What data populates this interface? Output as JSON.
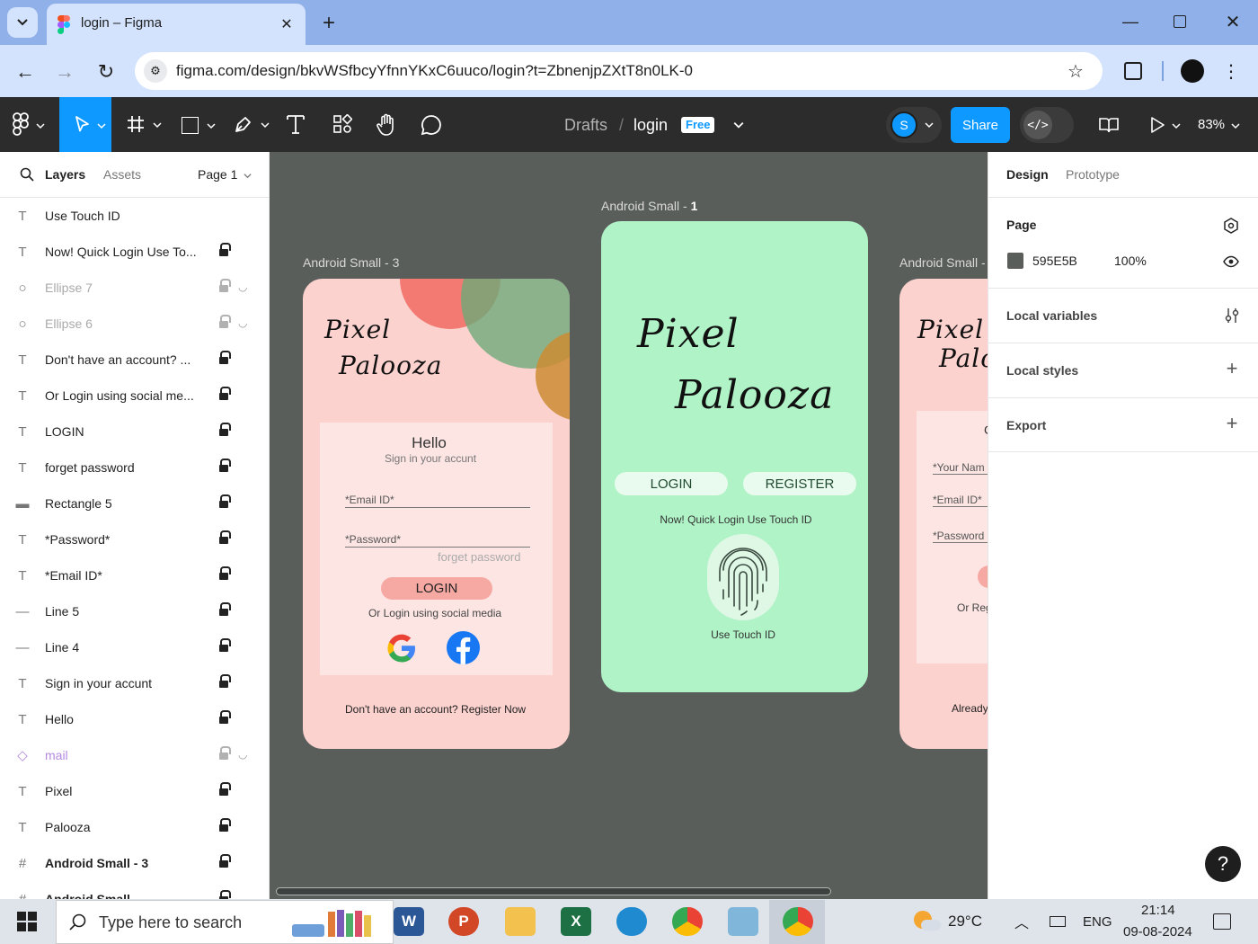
{
  "browser": {
    "tab_title": "login – Figma",
    "url": "figma.com/design/bkvWSfbcyYfnnYKxC6uuco/login?t=ZbnenjpZXtT8n0LK-0"
  },
  "toolbar": {
    "breadcrumb_parent": "Drafts",
    "breadcrumb_sep": "/",
    "file_name": "login",
    "plan_badge": "Free",
    "avatar_letter": "S",
    "share_label": "Share",
    "zoom": "83%"
  },
  "left_panel": {
    "tab_layers": "Layers",
    "tab_assets": "Assets",
    "page_selector": "Page 1",
    "layers": [
      {
        "name": "Use Touch ID",
        "type": "text",
        "locked": false
      },
      {
        "name": "Now! Quick Login Use To...",
        "type": "text",
        "locked": true
      },
      {
        "name": "Ellipse 7",
        "type": "ellipse",
        "locked": true,
        "hidden": true
      },
      {
        "name": "Ellipse 6",
        "type": "ellipse",
        "locked": true,
        "hidden": true
      },
      {
        "name": "Don't have an account? ...",
        "type": "text",
        "locked": true
      },
      {
        "name": "Or Login using social me...",
        "type": "text",
        "locked": true
      },
      {
        "name": "LOGIN",
        "type": "text",
        "locked": true
      },
      {
        "name": "forget password",
        "type": "text",
        "locked": true
      },
      {
        "name": "Rectangle 5",
        "type": "rect",
        "locked": true
      },
      {
        "name": "*Password*",
        "type": "text",
        "locked": true
      },
      {
        "name": "*Email ID*",
        "type": "text",
        "locked": true
      },
      {
        "name": "Line 5",
        "type": "line",
        "locked": true
      },
      {
        "name": "Line 4",
        "type": "line",
        "locked": true
      },
      {
        "name": "Sign in your accunt",
        "type": "text",
        "locked": true
      },
      {
        "name": "Hello",
        "type": "text",
        "locked": true
      },
      {
        "name": "mail",
        "type": "component",
        "locked": true,
        "hidden": true
      },
      {
        "name": "Pixel",
        "type": "text",
        "locked": true
      },
      {
        "name": "Palooza",
        "type": "text",
        "locked": true
      },
      {
        "name": "Android Small - 3",
        "type": "frame",
        "locked": true
      },
      {
        "name": "Android Small",
        "type": "frame",
        "locked": true
      }
    ]
  },
  "right_panel": {
    "tab_design": "Design",
    "tab_prototype": "Prototype",
    "page_heading": "Page",
    "page_color_hex": "595E5B",
    "page_opacity": "100%",
    "local_variables": "Local variables",
    "local_styles": "Local styles",
    "export": "Export"
  },
  "canvas": {
    "background": "#595e5b",
    "frame3": {
      "label": "Android Small - 3",
      "title_1": "Pixel",
      "title_2": "Palooza",
      "hello": "Hello",
      "subtitle": "Sign in your accunt",
      "email_placeholder": "*Email ID*",
      "password_placeholder": "*Password*",
      "forget": "forget password",
      "login_button": "LOGIN",
      "social_text": "Or Login using social media",
      "register_text": "Don't have an account? Register Now"
    },
    "frame1": {
      "label_prefix": "Android Small - ",
      "label_num": "1",
      "title_1": "Pixel",
      "title_2": "Palooza",
      "login_button": "LOGIN",
      "register_button": "REGISTER",
      "quick_login": "Now! Quick Login Use Touch ID",
      "touch_id": "Use Touch ID"
    },
    "frame_partial": {
      "label": "Android Small -",
      "title_1": "Pixel",
      "title_2": "Palo",
      "field_name": "*Your Nam",
      "field_email": "*Email ID*",
      "field_password": "*Password",
      "or_text": "Or Reg",
      "already_text": "Already",
      "hello_fragment": "C"
    }
  },
  "taskbar": {
    "search_placeholder": "Type here to search",
    "temperature": "29°C",
    "language": "ENG",
    "time": "21:14",
    "date": "09-08-2024"
  },
  "help": {
    "label": "?"
  },
  "colors": {
    "frame3_bg": "#fcd2cf",
    "frame1_bg": "#b0f3c7",
    "accent_blue": "#0d99ff",
    "figma_bar": "#2c2c2c"
  }
}
